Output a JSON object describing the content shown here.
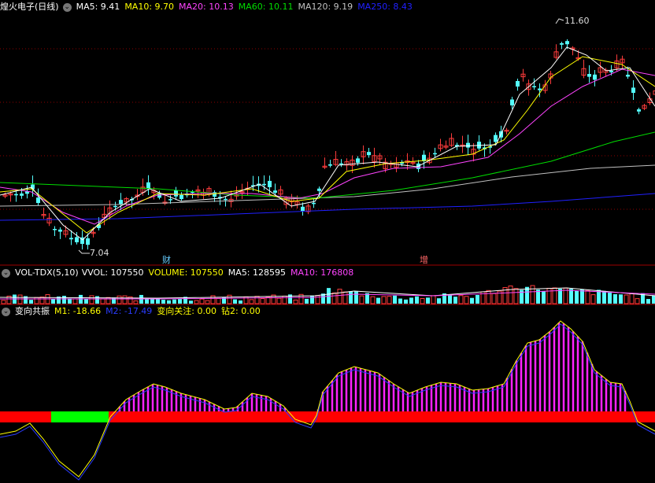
{
  "colors": {
    "background": "#000000",
    "grid": "#8b0000",
    "up_candle": "#ff3c3c",
    "down_candle": "#54ffff",
    "ma5": "#ffffff",
    "ma10": "#ffff00",
    "ma20": "#ff44ff",
    "ma60": "#00dd00",
    "ma120": "#c0c0c0",
    "ma250": "#2020ff",
    "bar_magenta": "#ff22ff",
    "band_red": "#ff0000",
    "band_green": "#00ff00",
    "m1_line": "#ffff00",
    "m2_line": "#2a3cff"
  },
  "price_panel": {
    "stock_name": "煌火电子(日线)",
    "chevron_icon": "chevron-down",
    "ma_items": [
      {
        "label": "MA5: 9.41",
        "color": "#ffffff"
      },
      {
        "label": "MA10: 9.70",
        "color": "#ffff00"
      },
      {
        "label": "MA20: 10.13",
        "color": "#ff44ff"
      },
      {
        "label": "MA60: 10.11",
        "color": "#00dd00"
      },
      {
        "label": "MA120: 9.19",
        "color": "#c0c0c0"
      },
      {
        "label": "MA250: 8.43",
        "color": "#2020ff"
      }
    ],
    "high_label": "11.60",
    "low_label": "7.04",
    "markers": [
      {
        "text": "财",
        "color": "#66ccff"
      },
      {
        "text": "增",
        "color": "#ff6666"
      }
    ]
  },
  "volume_panel": {
    "indicator": "VOL-TDX(5,10)",
    "items": [
      {
        "label": "VVOL: 107550",
        "color": "#ffffff"
      },
      {
        "label": "VOLUME: 107550",
        "color": "#ffff00"
      },
      {
        "label": "MA5: 128595",
        "color": "#ffffff"
      },
      {
        "label": "MA10: 176808",
        "color": "#ff44ff"
      }
    ]
  },
  "resonance_panel": {
    "indicator": "变向共振",
    "items": [
      {
        "label": "M1: -18.66",
        "color": "#ffff00"
      },
      {
        "label": "M2: -17.49",
        "color": "#2a3cff"
      },
      {
        "label": "变向关注: 0.00",
        "color": "#ffff00"
      },
      {
        "label": "钻2: 0.00",
        "color": "#ffff00"
      }
    ]
  }
}
